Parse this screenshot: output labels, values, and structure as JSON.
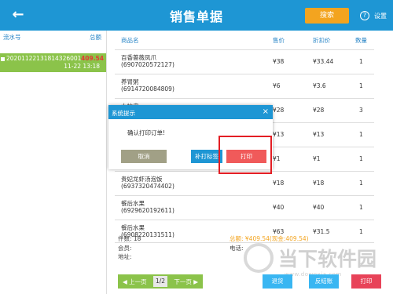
{
  "header": {
    "title": "销售单据",
    "back_icon": "arrow-left",
    "search_label": "搜索",
    "help_icon": "question-circle",
    "help_label": "设置"
  },
  "left_panel": {
    "col_serial": "流水号",
    "col_amount": "总额",
    "selected_order": {
      "serial": "20201122131814326001",
      "amount": "409.54",
      "time": "11-22 13:18"
    }
  },
  "table": {
    "headers": {
      "name": "商品名",
      "price": "售价",
      "discount": "折扣价",
      "qty": "数量"
    },
    "rows": [
      {
        "name": "百香蔷薇凤爪",
        "code": "(6907020572127)",
        "price": "¥38",
        "discount": "¥33.44",
        "qty": "1"
      },
      {
        "name": "养胃粥",
        "code": "(6914720084809)",
        "price": "¥6",
        "discount": "¥3.6",
        "qty": "1"
      },
      {
        "name": "大拉皮",
        "code": "",
        "price": "¥28",
        "discount": "¥28",
        "qty": "3"
      },
      {
        "name": "",
        "code": "",
        "price": "¥13",
        "discount": "¥13",
        "qty": "1"
      },
      {
        "name": "",
        "code": "",
        "price": "¥1",
        "discount": "¥1",
        "qty": "1"
      },
      {
        "name": "贵妃龙虾汤泡饭",
        "code": "(6937320474402)",
        "price": "¥18",
        "discount": "¥18",
        "qty": "1"
      },
      {
        "name": "餐后水果",
        "code": "(6929620192611)",
        "price": "¥40",
        "discount": "¥40",
        "qty": "1"
      },
      {
        "name": "餐后水果",
        "code": "(6908220131511)",
        "price": "¥63",
        "discount": "¥31.5",
        "qty": "1"
      }
    ]
  },
  "summary": {
    "count": "件数: 18",
    "member": "会员:",
    "address": "地址:",
    "total": "总额: ¥409.54(现金:409.54)",
    "phone": "电话:"
  },
  "pager": {
    "prev": "上一页",
    "page": "1/2",
    "next": "下一页"
  },
  "bottom_buttons": {
    "return": "退货",
    "unsettle": "反结账",
    "print": "打印"
  },
  "dialog": {
    "title": "系统提示",
    "close": "×",
    "message": "确认打印订单!",
    "cancel": "取消",
    "reprint": "补打标签",
    "print": "打印"
  },
  "watermark": {
    "cn": "当下软件园",
    "en": "www.downxia.com"
  },
  "colors": {
    "header_blue": "#1e96d4",
    "search_orange": "#f3a41f",
    "selected_green": "#8bc34a",
    "amount_red": "#e53935",
    "print_red": "#f05a5a",
    "highlight_red": "#e31e24"
  }
}
